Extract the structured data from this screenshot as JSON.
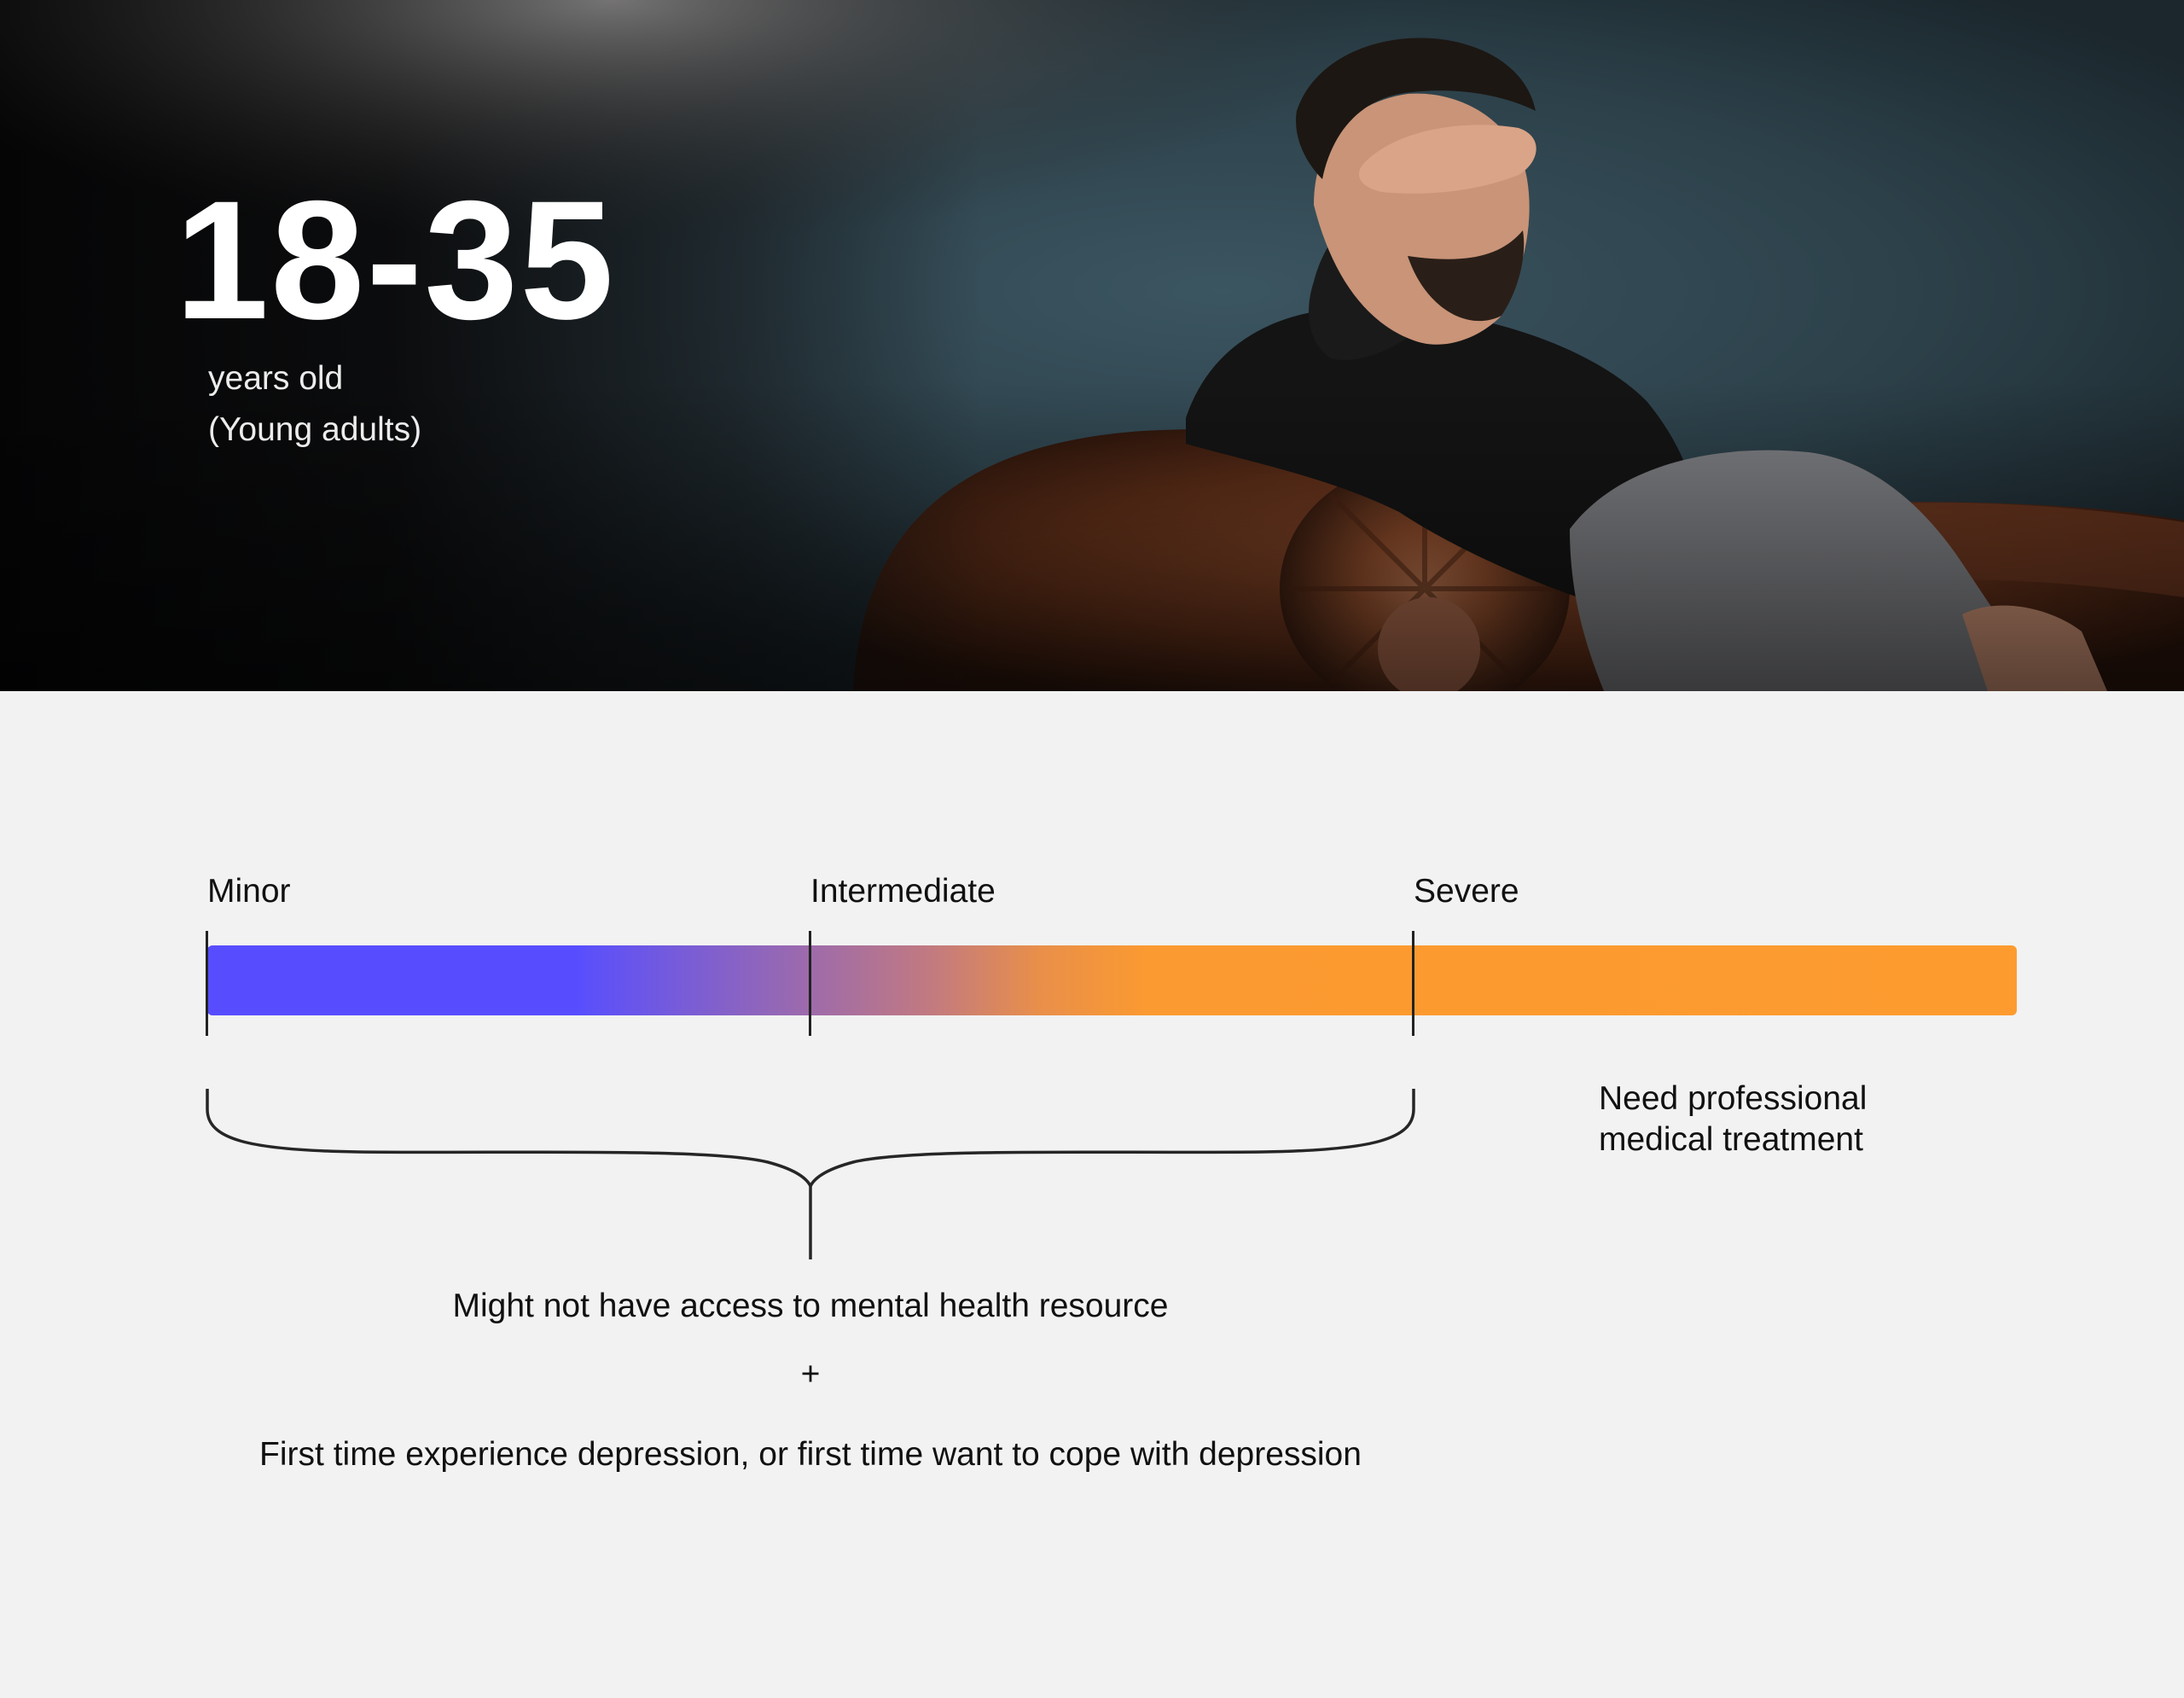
{
  "hero": {
    "age_range": "18-35",
    "subtitle_line1": "years old",
    "subtitle_line2": "(Young adults)",
    "photo": "photo of a man sitting on a brown leather sofa holding his hand to his forehead"
  },
  "scale": {
    "levels": [
      {
        "label": "Minor"
      },
      {
        "label": "Intermediate"
      },
      {
        "label": "Severe"
      }
    ],
    "colors": {
      "minor": "#574dff",
      "severe": "#fd9b2f"
    }
  },
  "notes": {
    "severe_line1": "Need professional",
    "severe_line2": "medical treatment",
    "line1": "Might not have access to mental health resource",
    "plus": "+",
    "line2": "First time experience depression, or first time want to cope with depression"
  }
}
